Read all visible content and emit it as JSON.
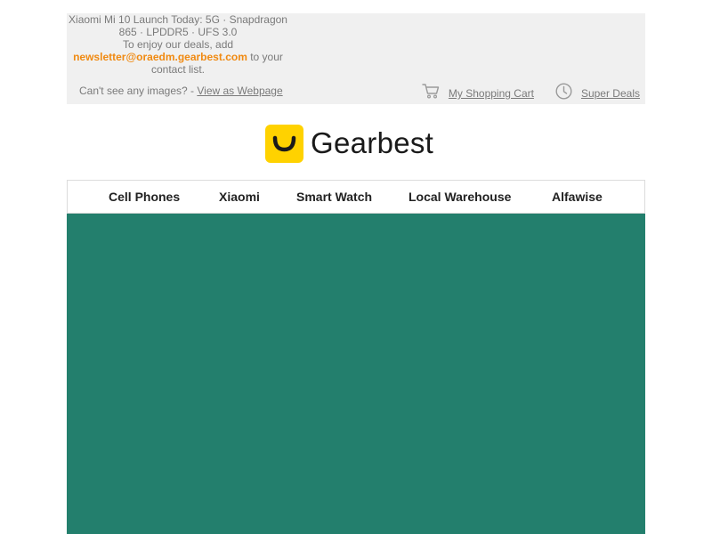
{
  "preheader": {
    "headline_line1": "Xiaomi Mi 10 Launch Today: 5G · Snapdragon",
    "headline_line2": "865 · LPDDR5 · UFS 3.0",
    "enjoy_text": "To enjoy our deals, add",
    "newsletter_email": "newsletter@oraedm.gearbest.com",
    "to_your_text": " to your",
    "contact_list_text": "contact list.",
    "cant_see_text": "Can't see any images? - ",
    "view_webpage_label": "View as Webpage",
    "shopping_cart_label": "My Shopping Cart",
    "super_deals_label": "Super Deals",
    "cart_icon": "shopping-cart-icon",
    "clock_icon": "clock-icon"
  },
  "brand": {
    "name": "Gearbest",
    "accent_color": "#ffd200",
    "link_color": "#f08a12"
  },
  "nav": {
    "items": [
      {
        "label": "Cell Phones"
      },
      {
        "label": "Xiaomi"
      },
      {
        "label": "Smart Watch"
      },
      {
        "label": "Local Warehouse"
      },
      {
        "label": "Alfawise"
      }
    ]
  },
  "hero": {
    "background_color": "#237f6d"
  }
}
